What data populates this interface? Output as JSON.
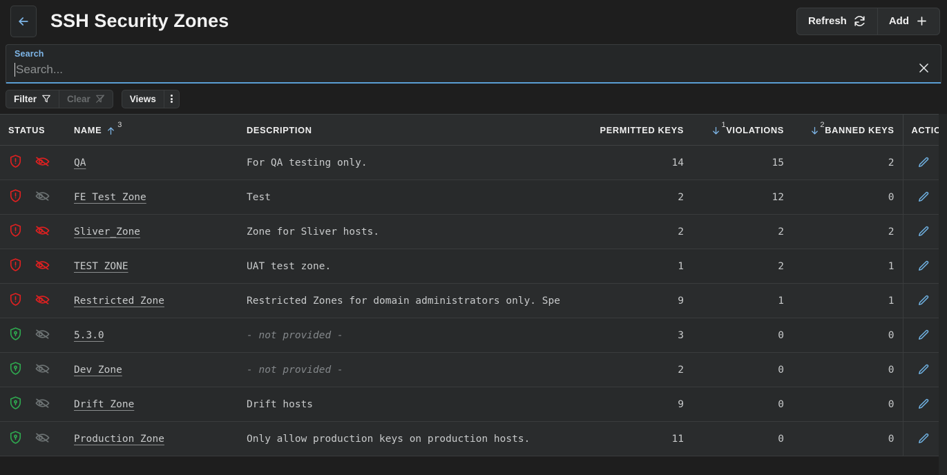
{
  "header": {
    "back_icon": "arrow-left-icon",
    "title": "SSH Security Zones",
    "refresh_label": "Refresh",
    "refresh_icon": "refresh-icon",
    "add_label": "Add",
    "add_icon": "plus-icon"
  },
  "search": {
    "label": "Search",
    "value": "",
    "placeholder": "Search...",
    "clear_icon": "close-icon"
  },
  "toolbar": {
    "filter_label": "Filter",
    "filter_icon": "funnel-icon",
    "clear_label": "Clear",
    "clear_icon": "funnel-off-icon",
    "views_label": "Views",
    "more_icon": "kebab-menu-icon"
  },
  "colors": {
    "accent": "#5a9fd4",
    "link": "#7eb6e8",
    "danger": "#e02020",
    "success": "#2fa84f",
    "muted": "#83878a",
    "panel": "#2b2d2e",
    "row_odd": "#2a2c2d",
    "row_even": "#282a2b"
  },
  "table": {
    "columns": [
      {
        "key": "status",
        "label": "STATUS"
      },
      {
        "key": "name",
        "label": "NAME",
        "sort": "asc",
        "sort_order": "3"
      },
      {
        "key": "desc",
        "label": "DESCRIPTION"
      },
      {
        "key": "permitted",
        "label": "PERMITTED KEYS"
      },
      {
        "key": "violations",
        "label": "VIOLATIONS",
        "sort": "desc",
        "sort_order": "1"
      },
      {
        "key": "banned",
        "label": "BANNED KEYS",
        "sort": "desc",
        "sort_order": "2"
      },
      {
        "key": "actions",
        "label": "ACTIONS"
      }
    ],
    "action_icons": {
      "edit": "pencil-icon",
      "delete": "trash-icon"
    },
    "rows": [
      {
        "shield": "alert",
        "shield_state": "danger",
        "eye": "eye-off",
        "eye_state": "danger",
        "name": "QA",
        "desc": "For QA testing only.",
        "desc_empty": false,
        "permitted": "14",
        "violations": "15",
        "banned": "2"
      },
      {
        "shield": "alert",
        "shield_state": "danger",
        "eye": "eye-off",
        "eye_state": "muted",
        "name": "FE Test Zone",
        "desc": "Test",
        "desc_empty": false,
        "permitted": "2",
        "violations": "12",
        "banned": "0"
      },
      {
        "shield": "alert",
        "shield_state": "danger",
        "eye": "eye-off",
        "eye_state": "danger",
        "name": "Sliver_Zone",
        "desc": "Zone for Sliver hosts.",
        "desc_empty": false,
        "permitted": "2",
        "violations": "2",
        "banned": "2"
      },
      {
        "shield": "alert",
        "shield_state": "danger",
        "eye": "eye-off",
        "eye_state": "danger",
        "name": "TEST ZONE",
        "desc": "UAT test zone.",
        "desc_empty": false,
        "permitted": "1",
        "violations": "2",
        "banned": "1"
      },
      {
        "shield": "alert",
        "shield_state": "danger",
        "eye": "eye-off",
        "eye_state": "danger",
        "name": "Restricted Zone",
        "desc": "Restricted Zones for domain administrators only. Spe",
        "desc_empty": false,
        "permitted": "9",
        "violations": "1",
        "banned": "1"
      },
      {
        "shield": "lock",
        "shield_state": "success",
        "eye": "eye-off",
        "eye_state": "muted",
        "name": "5.3.0",
        "desc": "- not provided -",
        "desc_empty": true,
        "permitted": "3",
        "violations": "0",
        "banned": "0"
      },
      {
        "shield": "lock",
        "shield_state": "success",
        "eye": "eye-off",
        "eye_state": "muted",
        "name": "Dev Zone",
        "desc": "- not provided -",
        "desc_empty": true,
        "permitted": "2",
        "violations": "0",
        "banned": "0"
      },
      {
        "shield": "lock",
        "shield_state": "success",
        "eye": "eye-off",
        "eye_state": "muted",
        "name": "Drift Zone",
        "desc": "Drift hosts",
        "desc_empty": false,
        "permitted": "9",
        "violations": "0",
        "banned": "0"
      },
      {
        "shield": "lock",
        "shield_state": "success",
        "eye": "eye-off",
        "eye_state": "muted",
        "name": "Production Zone",
        "desc": "Only allow production keys on production hosts.",
        "desc_empty": false,
        "permitted": "11",
        "violations": "0",
        "banned": "0"
      }
    ]
  }
}
